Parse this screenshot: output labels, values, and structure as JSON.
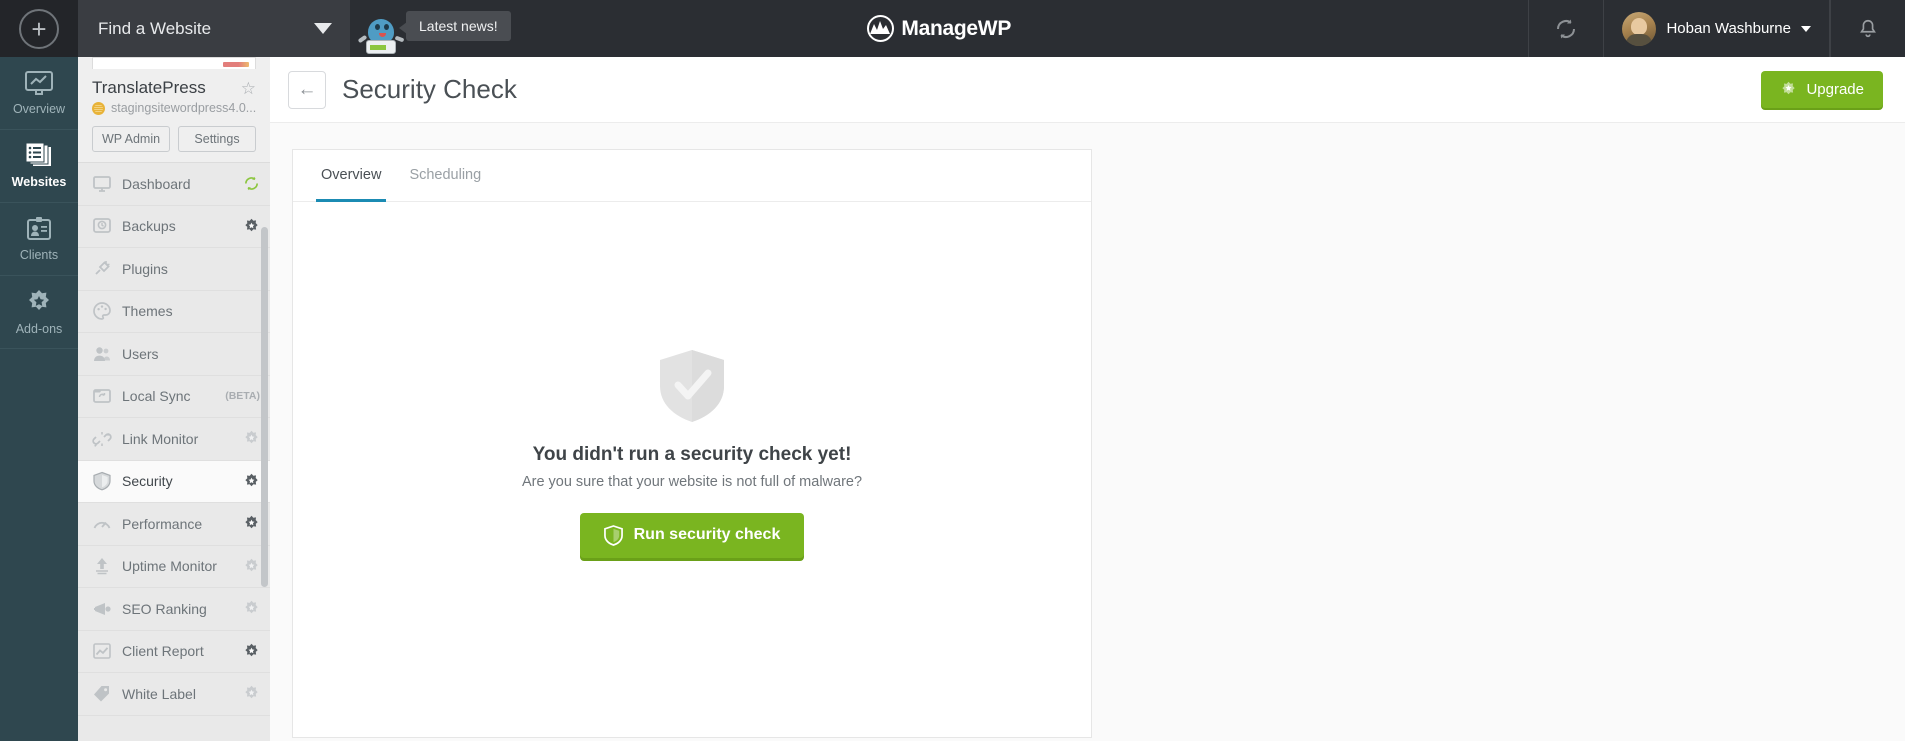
{
  "topbar": {
    "add_icon": "plus-circle-icon",
    "find_label": "Find a Website",
    "news_label": "Latest news!",
    "brand": "ManageWP",
    "sync_icon": "sync-icon",
    "bell_icon": "bell-icon",
    "user_name": "Hoban Washburne"
  },
  "rail": {
    "items": [
      {
        "label": "Overview",
        "icon": "monitor-chart-icon",
        "active": false
      },
      {
        "label": "Websites",
        "icon": "stacked-list-icon",
        "active": true
      },
      {
        "label": "Clients",
        "icon": "id-card-icon",
        "active": false
      },
      {
        "label": "Add-ons",
        "icon": "puzzle-star-icon",
        "active": false
      }
    ]
  },
  "sidebar": {
    "site_name": "TranslatePress",
    "site_url": "stagingsitewordpress4.0...",
    "favorite_icon": "star-outline-icon",
    "wp_icon": "wordpress-icon",
    "wp_admin_label": "WP Admin",
    "settings_label": "Settings",
    "items": [
      {
        "label": "Dashboard",
        "icon": "monitor-icon",
        "badge": "refresh",
        "active": false
      },
      {
        "label": "Backups",
        "icon": "hard-drive-icon",
        "badge": "gear-dark",
        "active": false
      },
      {
        "label": "Plugins",
        "icon": "plug-icon",
        "badge": "none",
        "active": false
      },
      {
        "label": "Themes",
        "icon": "palette-icon",
        "badge": "none",
        "active": false
      },
      {
        "label": "Users",
        "icon": "users-icon",
        "badge": "none",
        "active": false
      },
      {
        "label": "Local Sync",
        "icon": "sync-folder-icon",
        "badge": "none",
        "active": false,
        "tag": "(BETA)"
      },
      {
        "label": "Link Monitor",
        "icon": "broken-link-icon",
        "badge": "gear-light",
        "active": false
      },
      {
        "label": "Security",
        "icon": "shield-icon",
        "badge": "gear-dark",
        "active": true
      },
      {
        "label": "Performance",
        "icon": "gauge-icon",
        "badge": "gear-dark",
        "active": false
      },
      {
        "label": "Uptime Monitor",
        "icon": "arrow-up-icon",
        "badge": "gear-light",
        "active": false
      },
      {
        "label": "SEO Ranking",
        "icon": "megaphone-icon",
        "badge": "gear-light",
        "active": false
      },
      {
        "label": "Client Report",
        "icon": "chart-icon",
        "badge": "gear-dark",
        "active": false
      },
      {
        "label": "White Label",
        "icon": "tag-icon",
        "badge": "gear-light",
        "active": false
      }
    ]
  },
  "page": {
    "back_icon": "arrow-left-icon",
    "title": "Security Check",
    "upgrade_label": "Upgrade",
    "upgrade_icon": "gear-star-icon",
    "upgrade_color": "#7ab520"
  },
  "card": {
    "tabs": [
      {
        "label": "Overview",
        "active": true
      },
      {
        "label": "Scheduling",
        "active": false
      }
    ],
    "empty": {
      "icon": "shield-check-icon",
      "heading": "You didn't run a security check yet!",
      "subtext": "Are you sure that your website is not full of malware?",
      "button_label": "Run security check",
      "button_icon": "shield-icon",
      "button_color": "#7ab520"
    }
  },
  "theme": {
    "rail_bg": "#2f474f",
    "topbar_bg": "#2b2e33",
    "sidebar_bg": "#e9e9e9",
    "accent_tab": "#1b8bb3",
    "green": "#7ab520"
  }
}
